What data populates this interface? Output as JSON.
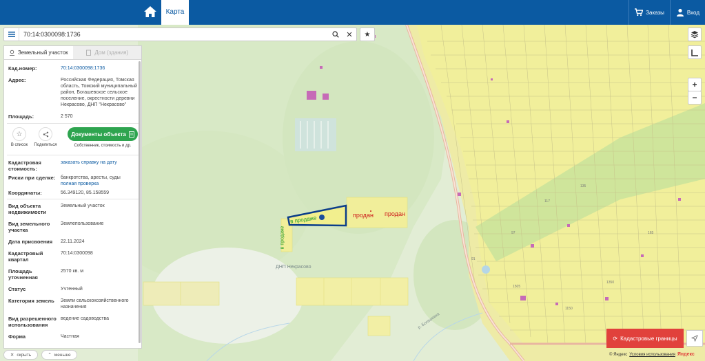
{
  "header": {
    "map_tab": "Карта",
    "orders": "Заказы",
    "login": "Вход"
  },
  "search": {
    "value": "70:14:0300098:1736"
  },
  "panel": {
    "tab_land": "Земельный участок",
    "tab_house": "Дом (здания)",
    "fields": [
      {
        "label": "Кад.номер:",
        "value": "70:14:0300098:1736",
        "link": true
      },
      {
        "label": "Адрес:",
        "value": "Российская Федерация, Томская область, Томский муниципальный район, Богашевское сельское поселение, окрестности деревни Некрасово, ДНП \"Некрасово\"",
        "link": false
      },
      {
        "label": "Площадь:",
        "value": "2 570",
        "link": false
      }
    ],
    "actions": {
      "favorite": "В список",
      "share": "Поделиться",
      "documents": "Документы объекта",
      "documents_sub": "Собственник, стоимость и др."
    },
    "details": [
      {
        "label": "Кадастровая стоимость:",
        "value": "заказать справку на дату",
        "value2": "",
        "link": true
      },
      {
        "label": "Риски при сделке:",
        "value": "банкротства, аресты, суды",
        "value2": "полная проверка",
        "link": false
      },
      {
        "label": "Координаты:",
        "value": "56.349120, 85.158559",
        "value2": "",
        "link": false
      },
      {
        "label": "Вид объекта недвижимости",
        "value": "Земельный участок",
        "value2": "",
        "link": false
      },
      {
        "label": "Вид земельного участка",
        "value": "Землепользование",
        "value2": "",
        "link": false
      },
      {
        "label": "Дата присвоения",
        "value": "22.11.2024",
        "value2": "",
        "link": false
      },
      {
        "label": "Кадастровый квартал",
        "value": "70:14:0300098",
        "value2": "",
        "link": false
      },
      {
        "label": "Площадь уточненная",
        "value": "2570 кв. м",
        "value2": "",
        "link": false
      },
      {
        "label": "Статус",
        "value": "Учтенный",
        "value2": "",
        "link": false
      },
      {
        "label": "Категория земель",
        "value": "Земли сельскохозяйственного назначения",
        "value2": "",
        "link": false
      },
      {
        "label": "Вид разрешенного использования",
        "value": "ведение садоводства",
        "value2": "",
        "link": false
      },
      {
        "label": "Форма",
        "value": "Частная",
        "value2": "",
        "link": false
      }
    ],
    "hide": "скрыть",
    "smaller": "меньше"
  },
  "map": {
    "label_for_sale_1": "в продаже",
    "label_for_sale_2": "в продаже",
    "label_sold_1": "продан",
    "label_sold_2": "продан",
    "label_settlement": "ДНП Некрасово",
    "label_road": "р. Богашевка",
    "parcel_numbers": [
      "165",
      "135",
      "117",
      "97",
      "91",
      "1505",
      "1350",
      "1150"
    ]
  },
  "controls": {
    "zoom_in": "+",
    "zoom_out": "−",
    "cadastral_borders": "Кадастровые границы"
  },
  "footer": {
    "copyright": "© Яндекс",
    "terms": "Условия использования",
    "brand": "Яндекс"
  },
  "colors": {
    "header_bg": "#0b5aa2",
    "green_button": "#2ea44f",
    "red_button": "#e1413c",
    "parcel_outline": "#0b3d8a",
    "sold_text": "#cc1a1a",
    "for_sale_text": "#1f9a2a"
  }
}
